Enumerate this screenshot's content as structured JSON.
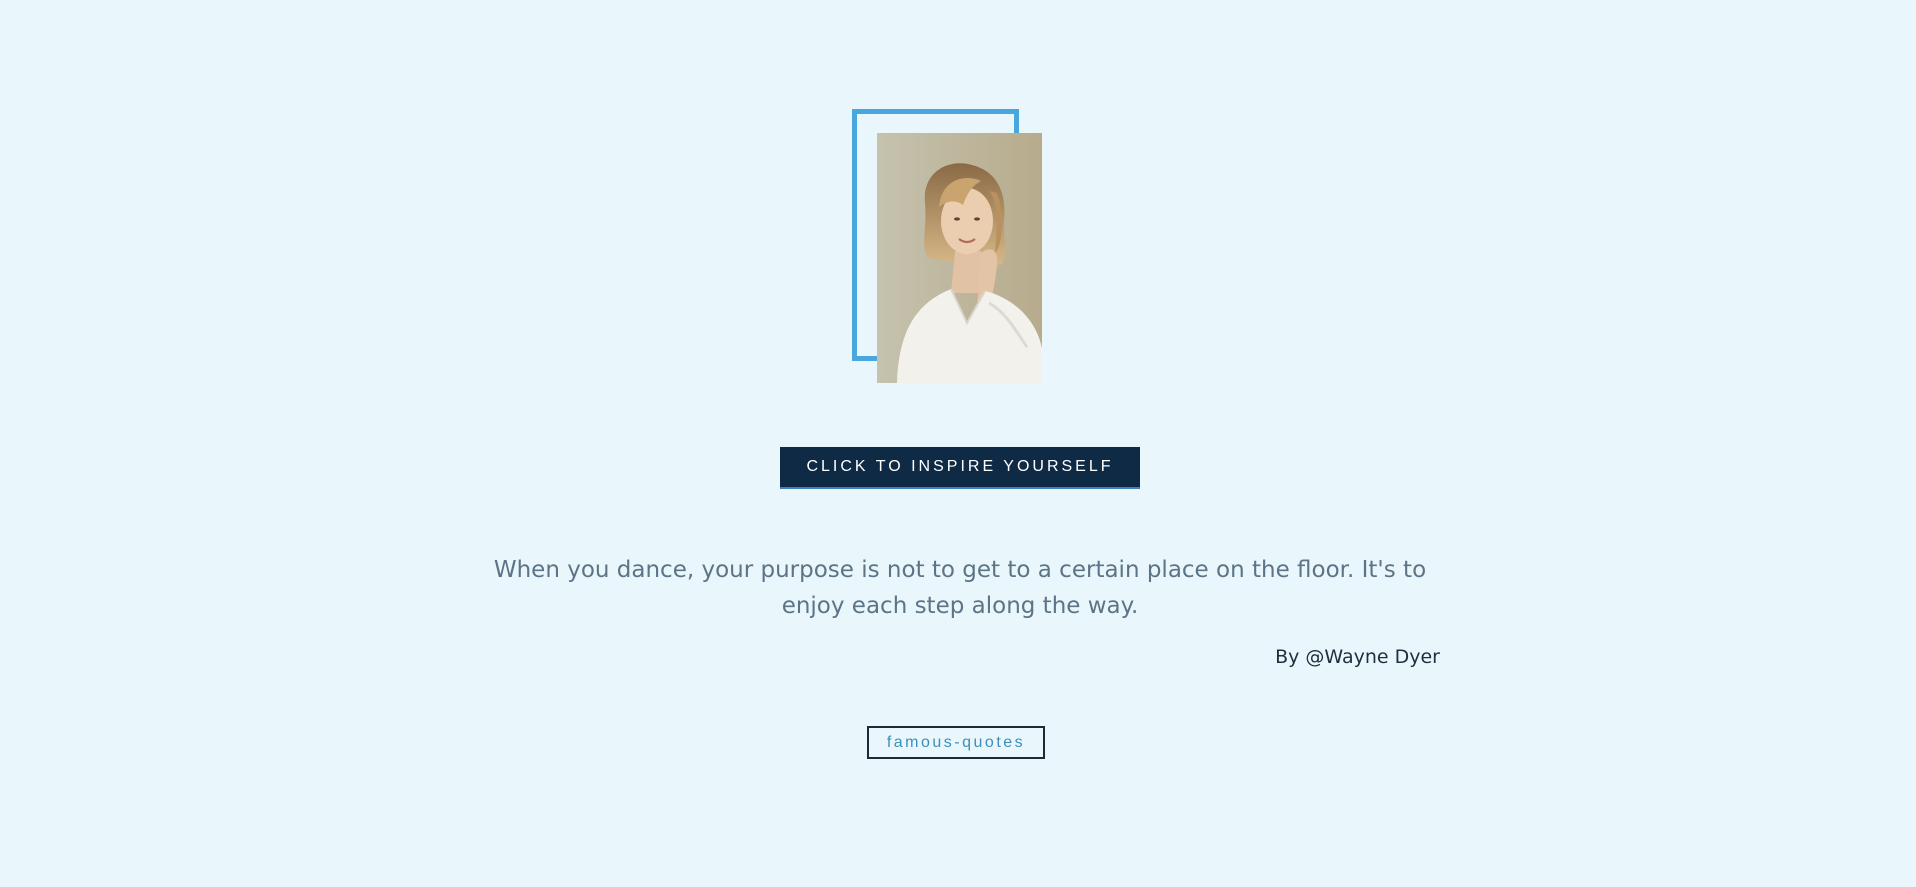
{
  "hero": {
    "photo_alt": "Portrait of a smiling woman"
  },
  "actions": {
    "inspire_label": "CLICK TO INSPIRE YOURSELF"
  },
  "quote": {
    "text": "When you dance, your purpose is not to get to a certain place on the floor. It's to enjoy each step along the way.",
    "author": "By @Wayne Dyer",
    "tag": "famous-quotes"
  },
  "colors": {
    "background": "#e9f7fd",
    "accent": "#4aa7de",
    "button_bg": "#0f2a45",
    "quote_text": "#5d7486",
    "tag_text": "#3c8fb9"
  }
}
